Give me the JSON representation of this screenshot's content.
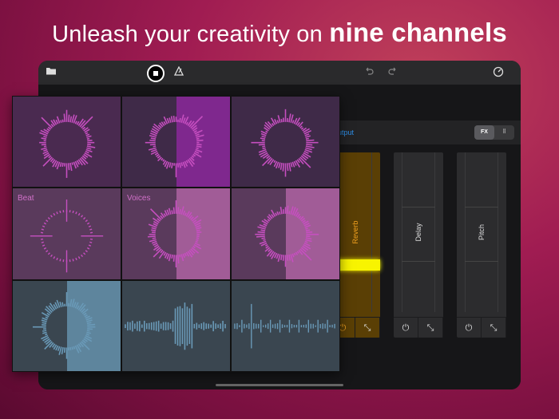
{
  "headline": {
    "prefix": "Unleash your creativity on ",
    "emphasis": "nine channels"
  },
  "toolbar": {
    "folder_icon": "folder-icon",
    "record_icon": "stop-record-icon",
    "metronome_icon": "metronome-icon",
    "undo_icon": "undo-icon",
    "redo_icon": "redo-icon",
    "settings_icon": "settings-icon"
  },
  "fx_panel": {
    "output_label": "utput",
    "segments": [
      "FX",
      "⫶⫶"
    ],
    "strips": [
      {
        "label": "Reverb",
        "active": true,
        "level": 0.33
      },
      {
        "label": "Delay",
        "active": false
      },
      {
        "label": "Pitch",
        "active": false
      }
    ]
  },
  "pads": [
    {
      "label": "",
      "style": "purple",
      "viz": "ring"
    },
    {
      "label": "",
      "style": "dpurple",
      "viz": "ring",
      "highlight": "purple"
    },
    {
      "label": "",
      "style": "dpurple",
      "viz": "ring"
    },
    {
      "label": "Beat",
      "style": "mauve",
      "viz": "crosshair"
    },
    {
      "label": "Voices",
      "style": "mauve",
      "viz": "ring",
      "highlight": "pink"
    },
    {
      "label": "",
      "style": "mauve",
      "viz": "ring",
      "highlight": "pink"
    },
    {
      "label": "",
      "style": "slate",
      "viz": "ring",
      "highlight": "blue"
    },
    {
      "label": "",
      "style": "slate",
      "viz": "wave"
    },
    {
      "label": "",
      "style": "slate",
      "viz": "spikes"
    }
  ],
  "colors": {
    "accent_pink": "#c64fc0",
    "accent_blue": "#6a9ab8",
    "reverb_bar": "#f8f400",
    "output_blue": "#2e8fe8"
  }
}
